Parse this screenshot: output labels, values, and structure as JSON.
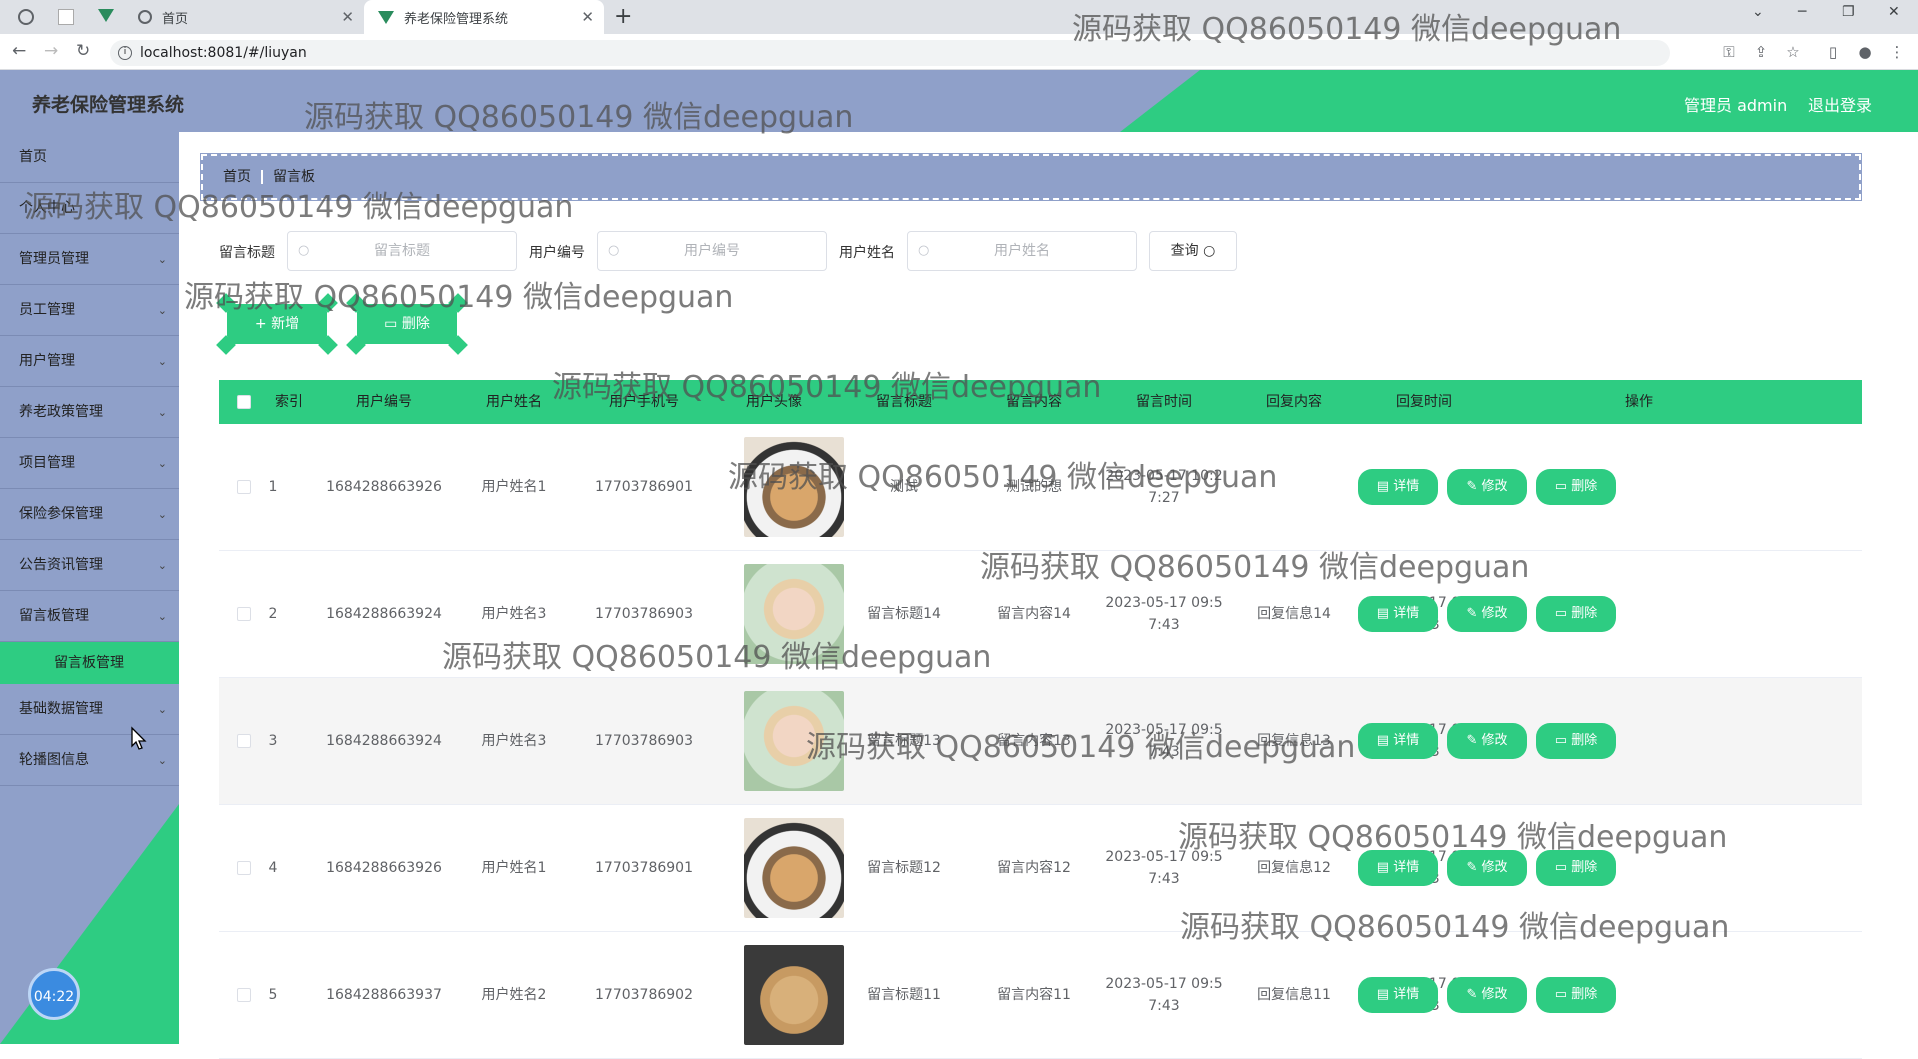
{
  "browser": {
    "tabs": [
      {
        "title": "首页"
      },
      {
        "title": "养老保险管理系统"
      }
    ],
    "url": "localhost:8081/#/liuyan"
  },
  "header": {
    "app_title": "养老保险管理系统",
    "admin_label": "管理员 admin",
    "logout_label": "退出登录"
  },
  "sidebar": {
    "items": [
      {
        "label": "首页",
        "has_children": false
      },
      {
        "label": "个人中心",
        "has_children": false
      },
      {
        "label": "管理员管理",
        "has_children": true
      },
      {
        "label": "员工管理",
        "has_children": true
      },
      {
        "label": "用户管理",
        "has_children": true
      },
      {
        "label": "养老政策管理",
        "has_children": true
      },
      {
        "label": "项目管理",
        "has_children": true
      },
      {
        "label": "保险参保管理",
        "has_children": true
      },
      {
        "label": "公告资讯管理",
        "has_children": true
      },
      {
        "label": "留言板管理",
        "has_children": true
      },
      {
        "label": "基础数据管理",
        "has_children": true
      },
      {
        "label": "轮播图信息",
        "has_children": true
      }
    ],
    "active_submenu": "留言板管理",
    "timer": "04:22"
  },
  "breadcrumb": [
    "首页",
    "留言板"
  ],
  "search": {
    "fields": [
      {
        "label": "留言标题",
        "placeholder": "留言标题"
      },
      {
        "label": "用户编号",
        "placeholder": "用户编号"
      },
      {
        "label": "用户姓名",
        "placeholder": "用户姓名"
      }
    ],
    "query_label": "查询"
  },
  "actions": {
    "add_label": "+ 新增",
    "delete_label": "删除"
  },
  "table": {
    "columns": [
      "索引",
      "用户编号",
      "用户姓名",
      "用户手机号",
      "用户头像",
      "留言标题",
      "留言内容",
      "留言时间",
      "回复内容",
      "回复时间",
      "操作"
    ],
    "rows": [
      {
        "index": "1",
        "user_no": "1684288663926",
        "name": "用户姓名1",
        "phone": "17703786901",
        "avatar": "cat-panda",
        "title": "测试",
        "content": "测试的想",
        "time1": "2023-05-17 10:2",
        "time2": "7:27",
        "reply": "",
        "rtime1": "",
        "rtime2": ""
      },
      {
        "index": "2",
        "user_no": "1684288663924",
        "name": "用户姓名3",
        "phone": "17703786903",
        "avatar": "person",
        "title": "留言标题14",
        "content": "留言内容14",
        "time1": "2023-05-17 09:5",
        "time2": "7:43",
        "reply": "回复信息14",
        "rtime1": "2023-05-17 09:5",
        "rtime2": "7:43"
      },
      {
        "index": "3",
        "user_no": "1684288663924",
        "name": "用户姓名3",
        "phone": "17703786903",
        "avatar": "person",
        "title": "留言标题13",
        "content": "留言内容13",
        "time1": "2023-05-17 09:5",
        "time2": "7:43",
        "reply": "回复信息13",
        "rtime1": "2023-05-17 09:5",
        "rtime2": "7:43"
      },
      {
        "index": "4",
        "user_no": "1684288663926",
        "name": "用户姓名1",
        "phone": "17703786901",
        "avatar": "cat-panda",
        "title": "留言标题12",
        "content": "留言内容12",
        "time1": "2023-05-17 09:5",
        "time2": "7:43",
        "reply": "回复信息12",
        "rtime1": "2023-05-17 09:5",
        "rtime2": "7:43"
      },
      {
        "index": "5",
        "user_no": "1684288663937",
        "name": "用户姓名2",
        "phone": "17703786902",
        "avatar": "puppy",
        "title": "留言标题11",
        "content": "留言内容11",
        "time1": "2023-05-17 09:5",
        "time2": "7:43",
        "reply": "回复信息11",
        "rtime1": "2023-05-17 09:5",
        "rtime2": "7:43"
      }
    ],
    "ops": {
      "detail": "详情",
      "edit": "修改",
      "delete": "删除"
    }
  },
  "watermark": "源码获取 QQ86050149 微信deepguan",
  "colors": {
    "accent": "#2ecc82",
    "sidebar": "#8fa0c9",
    "timer": "#3b8be0"
  }
}
